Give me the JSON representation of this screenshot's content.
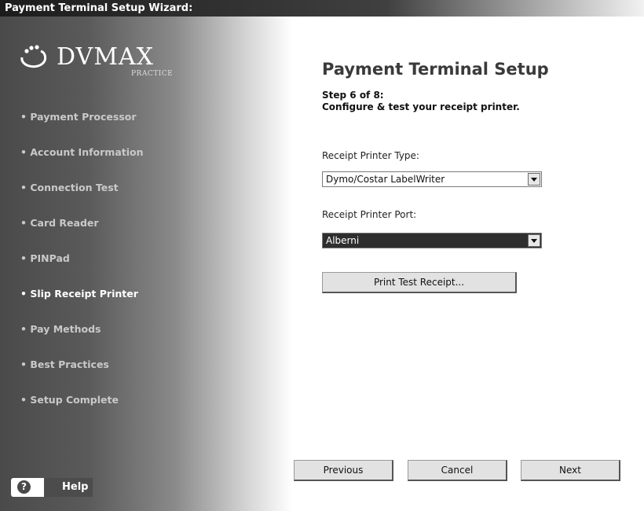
{
  "window": {
    "title": "Payment Terminal Setup Wizard:"
  },
  "logo": {
    "text": "DVMAX",
    "subtext": "PRACTICE"
  },
  "sidebar": {
    "steps": [
      {
        "label": "• Payment Processor",
        "active": false
      },
      {
        "label": "• Account Information",
        "active": false
      },
      {
        "label": "• Connection Test",
        "active": false
      },
      {
        "label": "• Card Reader",
        "active": false
      },
      {
        "label": "• PINPad",
        "active": false
      },
      {
        "label": "• Slip Receipt Printer",
        "active": true
      },
      {
        "label": "• Pay Methods",
        "active": false
      },
      {
        "label": "• Best Practices",
        "active": false
      },
      {
        "label": "• Setup Complete",
        "active": false
      }
    ],
    "help_label": "Help"
  },
  "main": {
    "title": "Payment Terminal Setup",
    "step_number": "Step 6 of 8:",
    "step_description": "Configure & test your receipt printer.",
    "printer_type": {
      "label": "Receipt Printer Type:",
      "value": "Dymo/Costar LabelWriter"
    },
    "printer_port": {
      "label": "Receipt Printer Port:",
      "value": "Alberni"
    },
    "test_button": "Print Test Receipt..."
  },
  "footer": {
    "previous": "Previous",
    "cancel": "Cancel",
    "next": "Next"
  }
}
